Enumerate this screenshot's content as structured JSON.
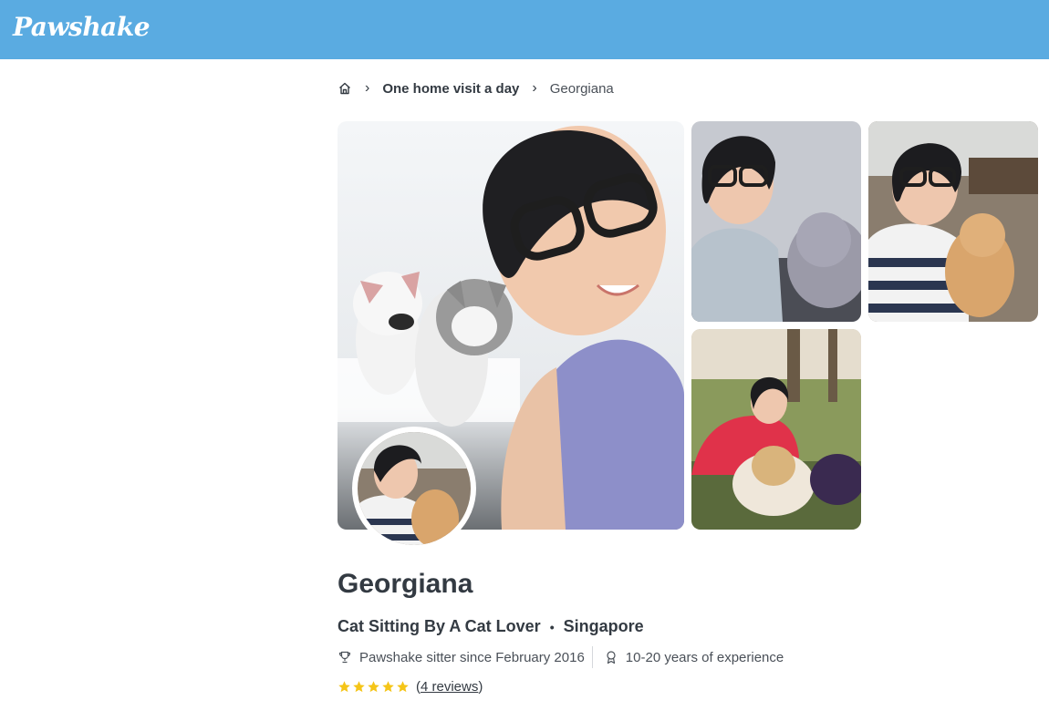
{
  "header": {
    "logo": "Pawshake",
    "background_color": "#5aabe1"
  },
  "breadcrumb": {
    "home_icon": "home-icon",
    "items": [
      {
        "label": "One home visit a day"
      },
      {
        "label": "Georgiana"
      }
    ]
  },
  "gallery": {
    "photos": [
      {
        "name": "sitter-with-kittens-photo"
      },
      {
        "name": "sitter-with-grey-cat-photo"
      },
      {
        "name": "sitter-with-orange-cat-photo"
      },
      {
        "name": "sitter-with-dog-at-beach-photo"
      }
    ]
  },
  "profile": {
    "name": "Georgiana",
    "headline": "Cat Sitting By A Cat Lover",
    "separator": "•",
    "location": "Singapore",
    "member_since": "Pawshake sitter since February 2016",
    "experience": "10-20 years of experience",
    "rating": {
      "stars": 5,
      "reviews_open": "(",
      "reviews_text": "4 reviews",
      "reviews_close": ")"
    }
  },
  "colors": {
    "accent": "#5aabe1",
    "star": "#f5c518",
    "text": "#333a42"
  }
}
